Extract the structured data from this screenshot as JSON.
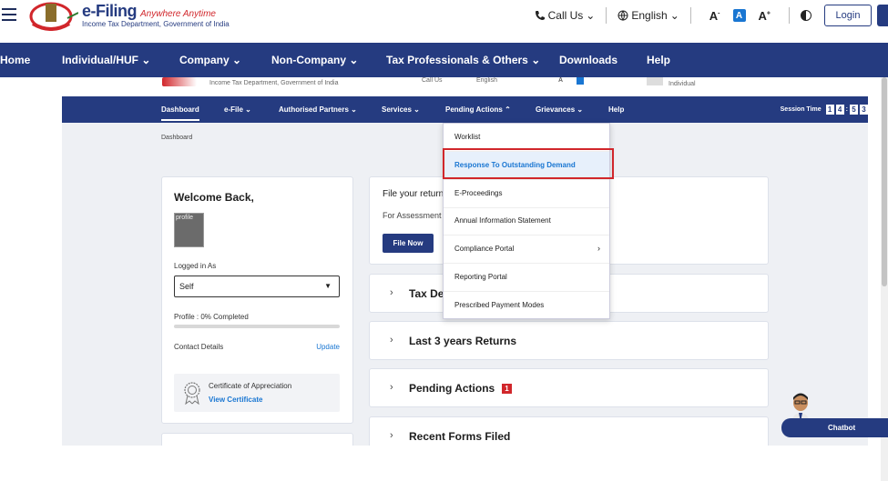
{
  "header": {
    "brand": "e-Filing",
    "tagline": "Anywhere Anytime",
    "department": "Income Tax Department, Government of India",
    "call_us": "Call Us",
    "language": "English",
    "font_decrease": "A",
    "font_normal": "A",
    "font_increase": "A",
    "login": "Login"
  },
  "outer_nav": [
    "Home",
    "Individual/HUF",
    "Company",
    "Non-Company",
    "Tax Professionals & Others",
    "Downloads",
    "Help"
  ],
  "inner_top": {
    "department": "Income Tax Department, Government of India",
    "call_us": "Call Us",
    "language": "English",
    "role": "Individual"
  },
  "inner_nav": {
    "items": [
      "Dashboard",
      "e-File",
      "Authorised Partners",
      "Services",
      "Pending Actions",
      "Grievances",
      "Help"
    ],
    "session_label": "Session Time",
    "session_digits": [
      "1",
      "4",
      "5",
      "3"
    ]
  },
  "breadcrumb": "Dashboard",
  "welcome": {
    "title": "Welcome Back,",
    "profile_alt": "profile",
    "logged_in_label": "Logged in As",
    "logged_in_value": "Self",
    "profile_status": "Profile : 0% Completed",
    "profile_percent": 0,
    "contact_label": "Contact Details",
    "update_link": "Update",
    "certificate_title": "Certificate of Appreciation",
    "certificate_link": "View Certificate"
  },
  "file_card": {
    "title": "File your return",
    "subtitle": "For Assessment",
    "button": "File Now"
  },
  "accordions": [
    {
      "label": "Tax Dep"
    },
    {
      "label": "Last 3 years Returns"
    },
    {
      "label": "Pending Actions",
      "badge": "1"
    },
    {
      "label": "Recent Forms Filed"
    }
  ],
  "pending_actions_menu": [
    "Worklist",
    "Response To Outstanding Demand",
    "E-Proceedings",
    "Annual Information Statement",
    "Compliance Portal",
    "Reporting Portal",
    "Prescribed Payment Modes"
  ],
  "chatbot": "Chatbot",
  "colors": {
    "primary": "#253b80",
    "accent": "#1976d2",
    "highlight": "#d1262b"
  }
}
